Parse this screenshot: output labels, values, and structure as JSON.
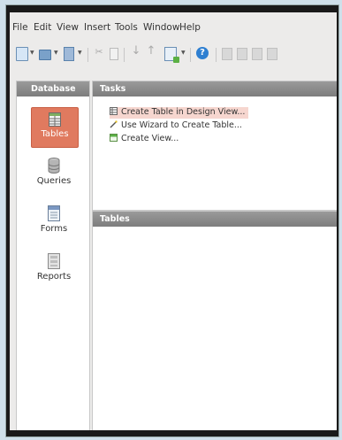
{
  "menu": [
    "File",
    "Edit",
    "View",
    "Insert",
    "Tools",
    "Window",
    "Help"
  ],
  "toolbar": {
    "icons": [
      "new-document-icon",
      "open-folder-icon",
      "save-icon",
      "cut-icon",
      "copy-icon",
      "sort-descending-icon",
      "sort-ascending-icon",
      "form-document-icon",
      "help-icon",
      "form-icon",
      "report-icon",
      "query-icon"
    ]
  },
  "sidebar": {
    "title": "Database",
    "items": [
      {
        "label": "Tables",
        "icon": "table-icon",
        "active": true
      },
      {
        "label": "Queries",
        "icon": "query-icon",
        "active": false
      },
      {
        "label": "Forms",
        "icon": "form-icon",
        "active": false
      },
      {
        "label": "Reports",
        "icon": "report-icon",
        "active": false
      }
    ]
  },
  "tasks": {
    "title": "Tasks",
    "items": [
      {
        "label": "Create Table in Design View...",
        "icon": "design-view-icon",
        "highlighted": true
      },
      {
        "label": "Use Wizard to Create Table...",
        "icon": "wizard-wand-icon",
        "highlighted": false
      },
      {
        "label": "Create View...",
        "icon": "view-icon",
        "highlighted": false
      }
    ]
  },
  "tables": {
    "title": "Tables"
  },
  "colors": {
    "accent": "#e07a5f",
    "header": "#8a8a8a"
  }
}
